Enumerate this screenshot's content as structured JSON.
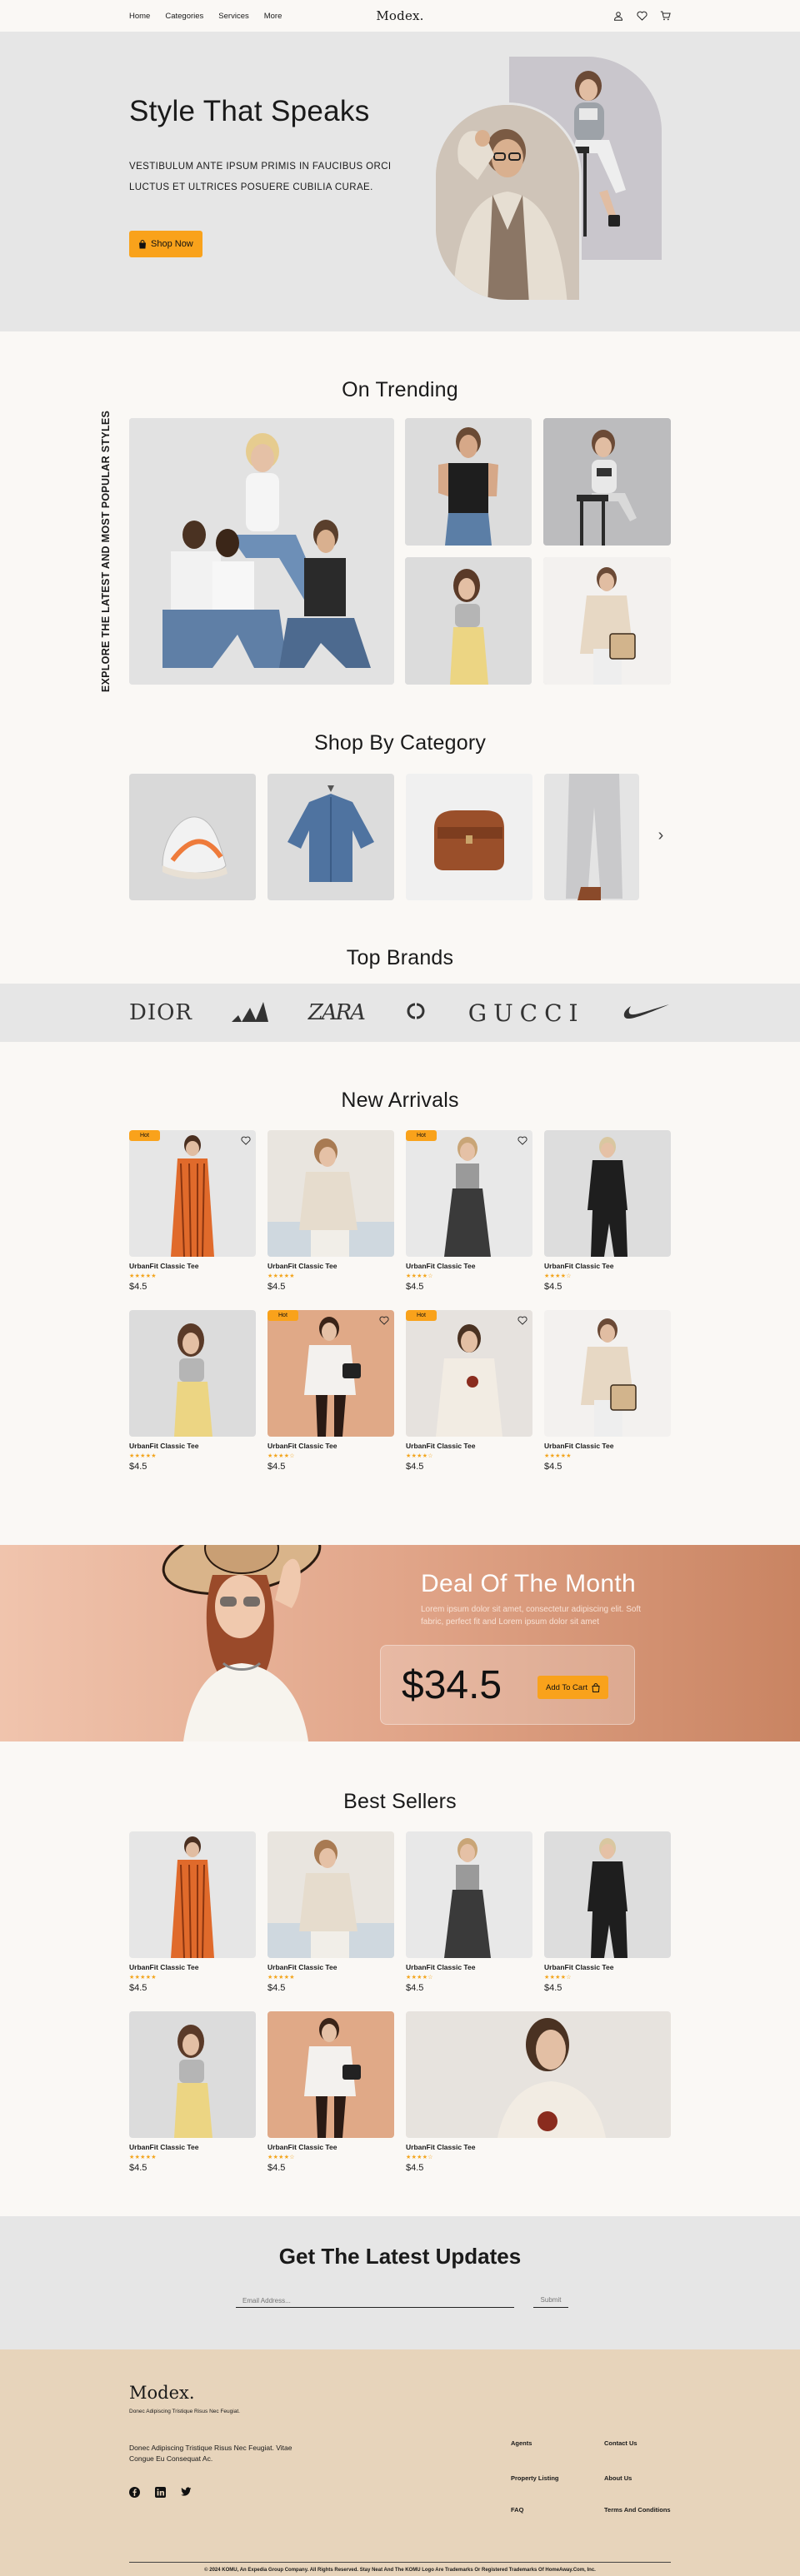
{
  "nav": {
    "links": [
      "Home",
      "Categories",
      "Services",
      "More"
    ],
    "logo": "Modex."
  },
  "hero": {
    "title": "Style That Speaks",
    "subtitle": "VESTIBULUM ANTE IPSUM PRIMIS IN FAUCIBUS ORCI LUCTUS ET ULTRICES POSUERE CUBILIA CURAE.",
    "cta": "Shop Now"
  },
  "trending": {
    "title": "On Trending",
    "side_text": "EXPLORE THE LATEST AND MOST POPULAR STYLES"
  },
  "categories": {
    "title": "Shop By Category"
  },
  "brands": {
    "title": "Top Brands",
    "names": [
      "DIOR",
      "ZARA",
      "GUCCI"
    ]
  },
  "new_arrivals": {
    "title": "New Arrivals",
    "badge": "Hot",
    "items": [
      {
        "name": "UrbanFit Classic Tee",
        "rating": "★★★★★",
        "price": "$4.5"
      },
      {
        "name": "UrbanFit Classic Tee",
        "rating": "★★★★★",
        "price": "$4.5"
      },
      {
        "name": "UrbanFit Classic Tee",
        "rating": "★★★★☆",
        "price": "$4.5"
      },
      {
        "name": "UrbanFit Classic Tee",
        "rating": "★★★★☆",
        "price": "$4.5"
      },
      {
        "name": "UrbanFit Classic Tee",
        "rating": "★★★★★",
        "price": "$4.5"
      },
      {
        "name": "UrbanFit Classic Tee",
        "rating": "★★★★☆",
        "price": "$4.5"
      },
      {
        "name": "UrbanFit Classic Tee",
        "rating": "★★★★☆",
        "price": "$4.5"
      },
      {
        "name": "UrbanFit Classic Tee",
        "rating": "★★★★★",
        "price": "$4.5"
      }
    ]
  },
  "deal": {
    "title": "Deal Of The Month",
    "description": "Lorem ipsum dolor sit amet, consectetur adipiscing elit. Soft fabric, perfect fit and Lorem ipsum dolor sit amet",
    "price": "$34.5",
    "cta": "Add To Cart"
  },
  "best_sellers": {
    "title": "Best Sellers",
    "items": [
      {
        "name": "UrbanFit Classic Tee",
        "rating": "★★★★★",
        "price": "$4.5"
      },
      {
        "name": "UrbanFit Classic Tee",
        "rating": "★★★★★",
        "price": "$4.5"
      },
      {
        "name": "UrbanFit Classic Tee",
        "rating": "★★★★☆",
        "price": "$4.5"
      },
      {
        "name": "UrbanFit Classic Tee",
        "rating": "★★★★☆",
        "price": "$4.5"
      },
      {
        "name": "UrbanFit Classic Tee",
        "rating": "★★★★★",
        "price": "$4.5"
      },
      {
        "name": "UrbanFit Classic Tee",
        "rating": "★★★★☆",
        "price": "$4.5"
      },
      {
        "name": "UrbanFit Classic Tee",
        "rating": "★★★★☆",
        "price": "$4.5"
      }
    ]
  },
  "newsletter": {
    "title": "Get The Latest Updates",
    "placeholder": "Email Address...",
    "submit": "Submit"
  },
  "footer": {
    "logo": "Modex.",
    "tagline": "Donec Adipiscing Tristique Risus Nec Feugiat.",
    "address": "Donec Adipiscing Tristique Risus Nec Feugiat. Vitae Congue Eu Consequat Ac.",
    "links": [
      "Agents",
      "Contact Us",
      "Property Listing",
      "About Us",
      "FAQ",
      "Terms And Conditions"
    ],
    "copyright": "© 2024 KOMU, An Expedia Group Company. All Rights Reserved. Stay Neat And The KOMU Logo Are Trademarks Or Registered Trademarks Of HomeAway.Com, Inc."
  },
  "colors": {
    "accent": "#f9a21b",
    "hero_bg": "#e6e6e6",
    "page_bg": "#faf8f5",
    "footer_bg": "#e7d4bb",
    "deal_gradient_start": "#f0c4ad",
    "deal_gradient_end": "#c98462",
    "star": "#f3a51d"
  }
}
